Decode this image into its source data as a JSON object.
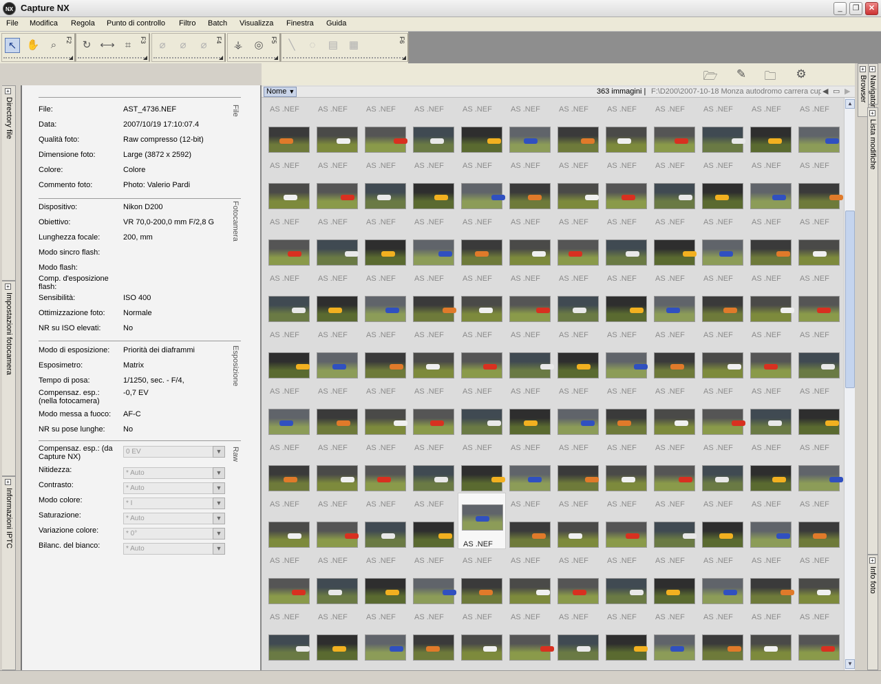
{
  "window": {
    "title": "Capture NX",
    "logo": "NX",
    "minimize": "_",
    "maximize": "❐",
    "close": "✕"
  },
  "menu": [
    "File",
    "Modifica",
    "Regola",
    "Punto di controllo",
    "Filtro",
    "Batch",
    "Visualizza",
    "Finestra",
    "Guida"
  ],
  "toolbar": {
    "groups": [
      {
        "label": "F2",
        "tools": [
          {
            "icon": "arrow-select-icon",
            "glyph": "↖",
            "active": true
          },
          {
            "icon": "hand-icon",
            "glyph": "✋"
          },
          {
            "icon": "zoom-icon",
            "glyph": "⌕"
          }
        ]
      },
      {
        "label": "F3",
        "tools": [
          {
            "icon": "rotate-icon",
            "glyph": "↻"
          },
          {
            "icon": "straighten-icon",
            "glyph": "⟷"
          },
          {
            "icon": "crop-icon",
            "glyph": "⌗"
          }
        ]
      },
      {
        "label": "F4",
        "tools": [
          {
            "icon": "red-eye-brush-icon",
            "glyph": "⌀",
            "dim": true
          },
          {
            "icon": "brush-icon",
            "glyph": "⌀",
            "dim": true
          },
          {
            "icon": "brush-erase-icon",
            "glyph": "⌀",
            "dim": true
          }
        ]
      },
      {
        "label": "F5",
        "tools": [
          {
            "icon": "black-point-icon",
            "glyph": "⚶"
          },
          {
            "icon": "red-eye-icon",
            "glyph": "◎"
          }
        ]
      },
      {
        "label": "F6",
        "tools": [
          {
            "icon": "selection-brush-icon",
            "glyph": "╲",
            "dim": true
          },
          {
            "icon": "lasso-icon",
            "glyph": "◌",
            "dim": true
          },
          {
            "icon": "gradient-icon",
            "glyph": "▤",
            "dim": true
          },
          {
            "icon": "fill-icon",
            "glyph": "▦",
            "dim": true
          }
        ]
      }
    ]
  },
  "left_tabs": [
    "Directory file",
    "Impostazioni fotocamera",
    "Informazioni IPTC"
  ],
  "right_tabs": [
    "Navigatore",
    "Browser",
    "Lista modifiche",
    "Info foto"
  ],
  "metadata": {
    "file": {
      "section": "File",
      "rows": [
        [
          "File:",
          "AST_4736.NEF"
        ],
        [
          "Data:",
          "2007/10/19 17:10:07.4"
        ],
        [
          "Qualità foto:",
          "Raw compresso (12-bit)"
        ],
        [
          "Dimensione foto:",
          "Large (3872 x 2592)"
        ],
        [
          "Colore:",
          "Colore"
        ],
        [
          "Commento foto:",
          "Photo: Valerio Pardi"
        ]
      ]
    },
    "camera": {
      "section": "Fotocamera",
      "rows": [
        [
          "Dispositivo:",
          "Nikon D200"
        ],
        [
          "Obiettivo:",
          "VR 70,0-200,0 mm F/2,8 G"
        ],
        [
          "Lunghezza focale:",
          "200, mm"
        ],
        [
          "Modo sincro flash:",
          ""
        ],
        [
          "Modo flash:",
          ""
        ],
        [
          "Comp. d'esposizione flash:",
          ""
        ],
        [
          "Sensibilità:",
          "ISO 400"
        ],
        [
          "Ottimizzazione foto:",
          "Normale"
        ],
        [
          "NR su ISO elevati:",
          "No"
        ]
      ]
    },
    "exposure": {
      "section": "Esposizione",
      "rows": [
        [
          "Modo di esposizione:",
          "Priorità dei diaframmi"
        ],
        [
          "Esposimetro:",
          "Matrix"
        ],
        [
          "Tempo di posa:",
          "1/1250, sec. - F/4,"
        ],
        [
          "Compensaz. esp.: (nella fotocamera)",
          "-0,7 EV"
        ],
        [
          "Modo messa a fuoco:",
          "AF-C"
        ],
        [
          "NR su pose lunghe:",
          "No"
        ]
      ]
    },
    "raw": {
      "section": "Raw",
      "rows": [
        [
          "Compensaz. esp.: (da Capture NX)",
          "0 EV"
        ],
        [
          "Nitidezza:",
          "* Auto"
        ],
        [
          "Contrasto:",
          "* Auto"
        ],
        [
          "Modo colore:",
          "* I"
        ],
        [
          "Saturazione:",
          "* Auto"
        ],
        [
          "Variazione colore:",
          "* 0°"
        ],
        [
          "Bilanc. del bianco:",
          "* Auto"
        ]
      ]
    }
  },
  "browser": {
    "sort": "Nome",
    "count": "363 immagini |",
    "path": "F:\\D200\\2007-10-18 Monza autodromo carrera cup",
    "thumb_label": "AS .NEF",
    "selected_index": 88,
    "toolbar_icons": [
      "open-folder-icon",
      "rename-icon",
      "move-folder-icon",
      "settings-icon"
    ]
  },
  "colors": {
    "panel_bg": "#f3f3f3",
    "browser_bg": "#dcdcdc",
    "accent": "#c7d6ee"
  }
}
